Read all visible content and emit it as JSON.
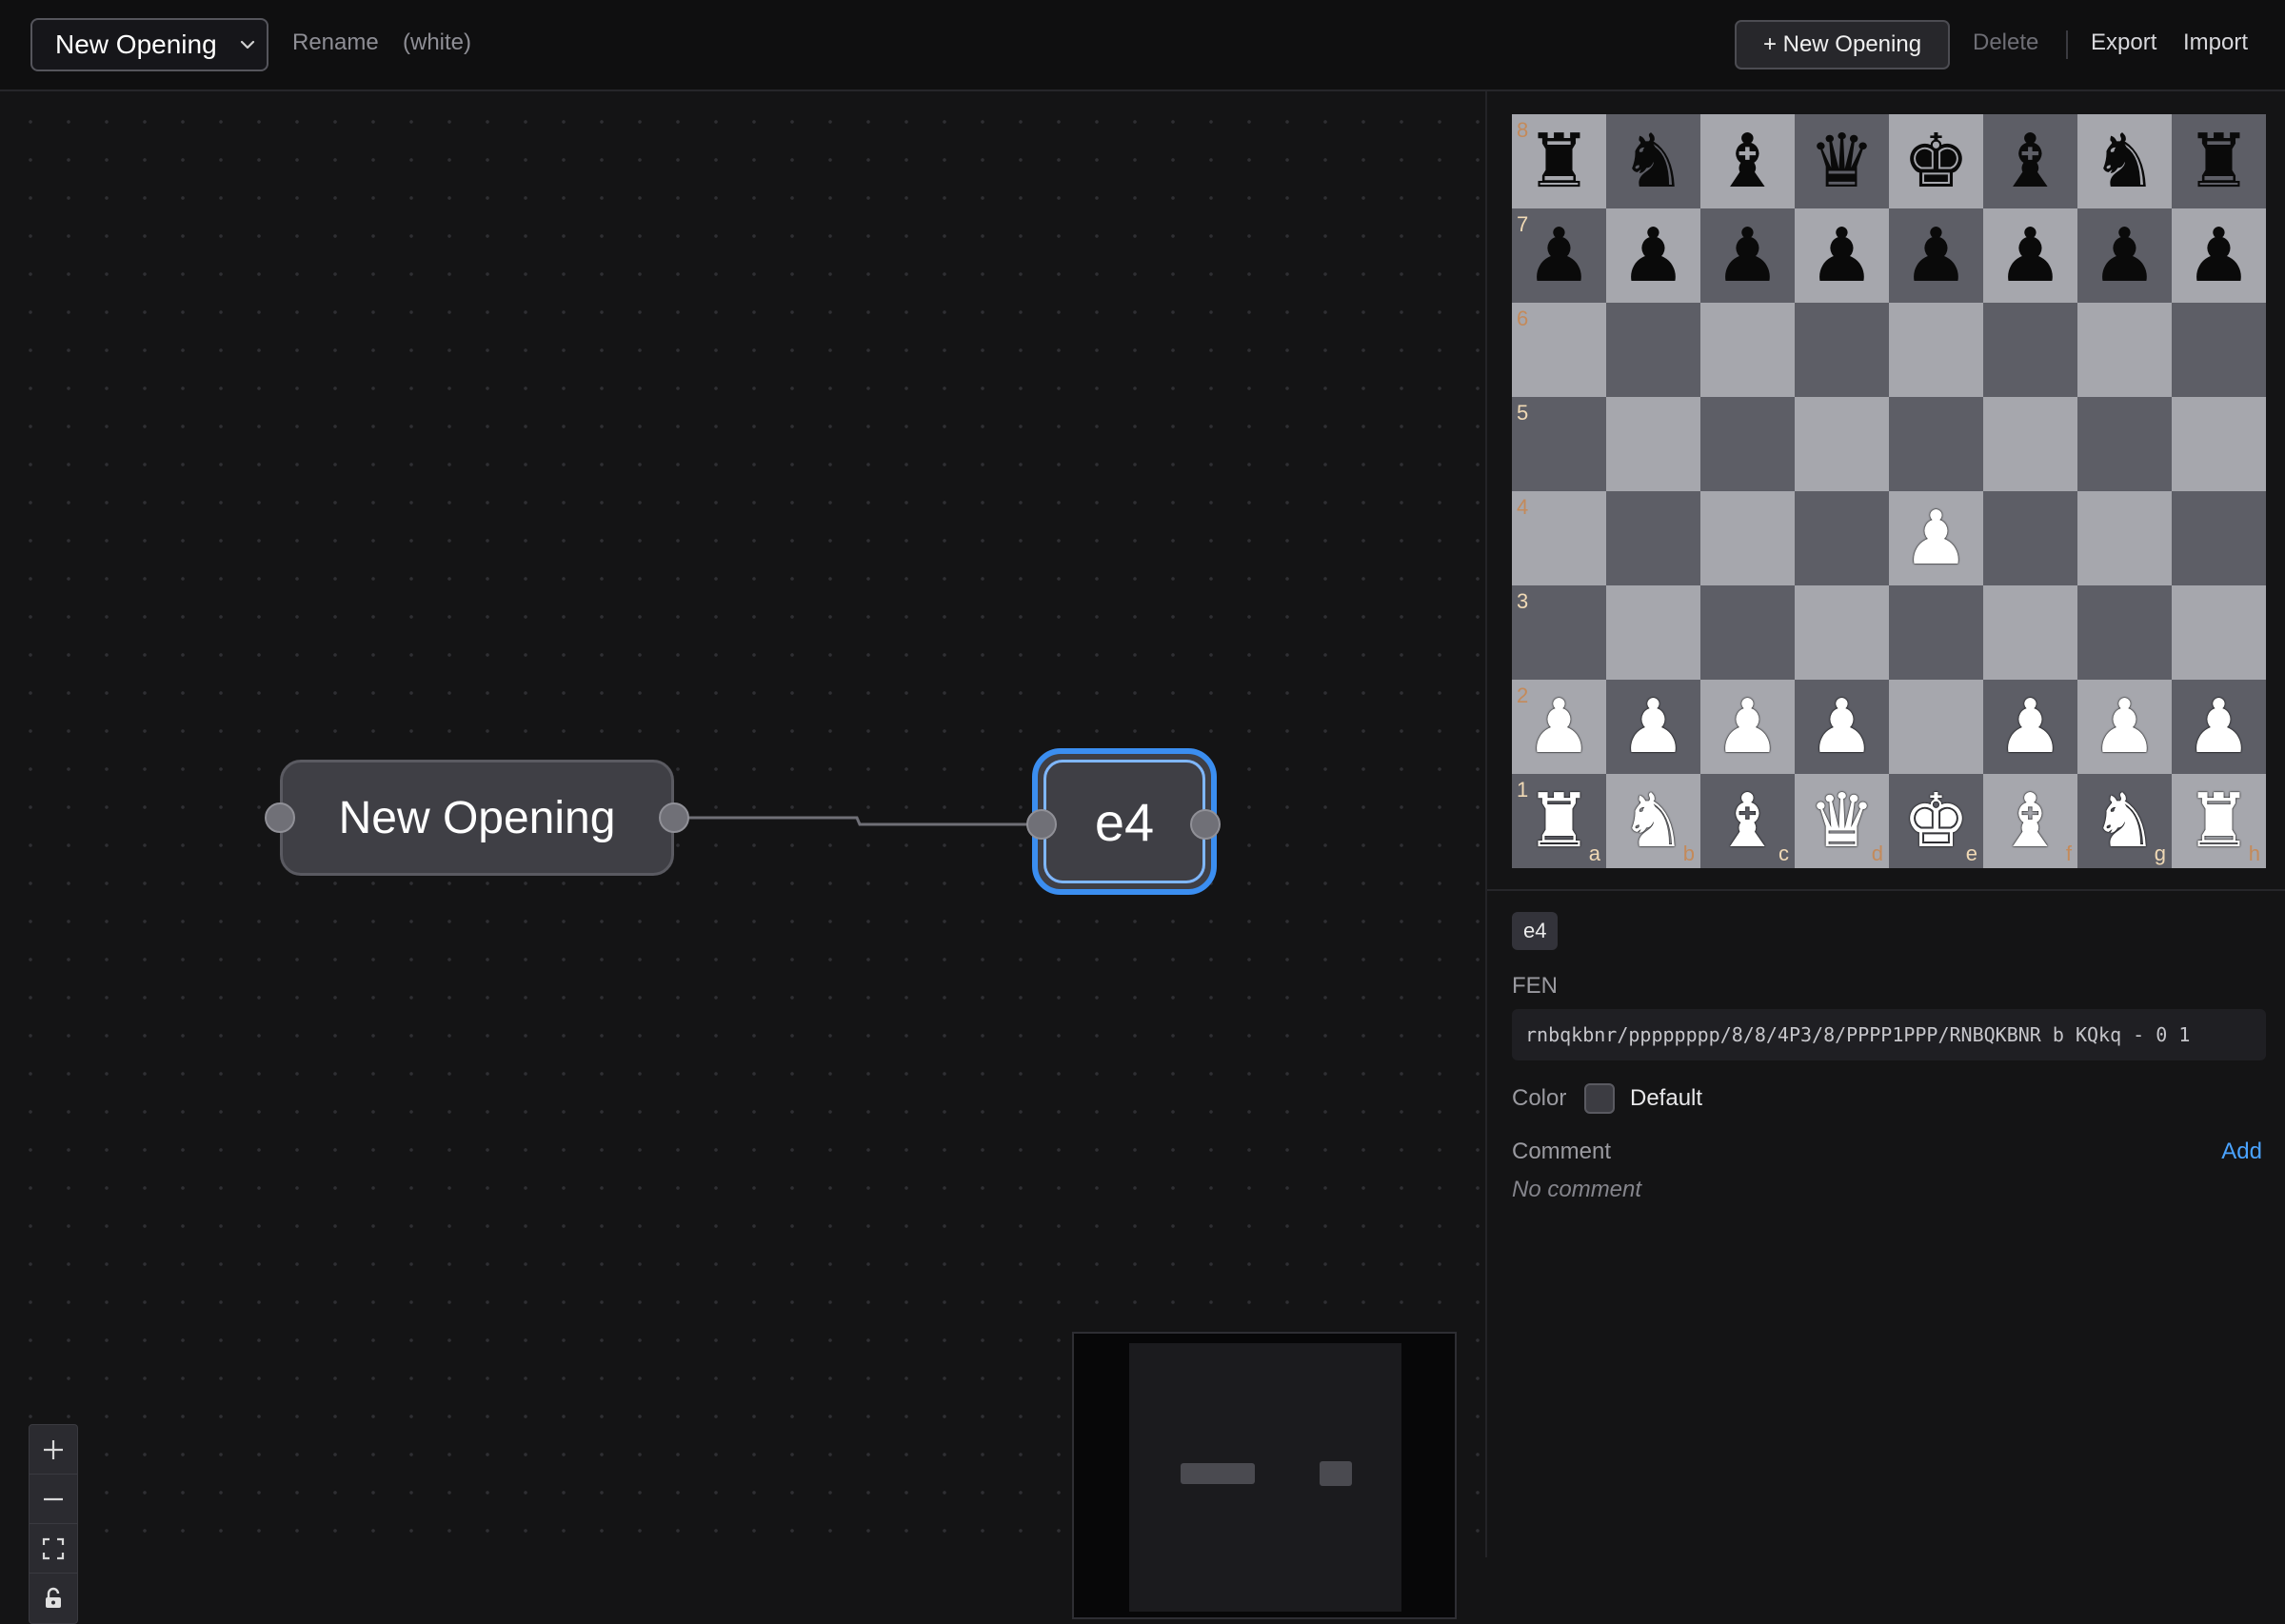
{
  "header": {
    "opening_name": "New Opening",
    "rename_label": "Rename",
    "side_label": "(white)",
    "new_opening_label": "+ New Opening",
    "delete_label": "Delete",
    "export_label": "Export",
    "import_label": "Import"
  },
  "graph": {
    "nodes": [
      {
        "label": "New Opening"
      },
      {
        "label": "e4",
        "selected": true
      }
    ],
    "accent_color": "#3b8ef0",
    "controls": [
      "zoom-in-icon",
      "zoom-out-icon",
      "fit-view-icon",
      "lock-icon"
    ]
  },
  "board": {
    "ranks": [
      [
        "r",
        "n",
        "b",
        "q",
        "k",
        "b",
        "n",
        "r"
      ],
      [
        "p",
        "p",
        "p",
        "p",
        "p",
        "p",
        "p",
        "p"
      ],
      [
        "",
        "",
        "",
        "",
        "",
        "",
        "",
        ""
      ],
      [
        "",
        "",
        "",
        "",
        "",
        "",
        "",
        ""
      ],
      [
        "",
        "",
        "",
        "",
        "P",
        "",
        "",
        ""
      ],
      [
        "",
        "",
        "",
        "",
        "",
        "",
        "",
        ""
      ],
      [
        "P",
        "P",
        "P",
        "P",
        "",
        "P",
        "P",
        "P"
      ],
      [
        "R",
        "N",
        "B",
        "Q",
        "K",
        "B",
        "N",
        "R"
      ]
    ],
    "rank_labels": [
      "8",
      "7",
      "6",
      "5",
      "4",
      "3",
      "2",
      "1"
    ],
    "file_labels": [
      "a",
      "b",
      "c",
      "d",
      "e",
      "f",
      "g",
      "h"
    ],
    "light_color": "#a6a7ad",
    "dark_color": "#5d5e66"
  },
  "details": {
    "move": "e4",
    "fen_label": "FEN",
    "fen": "rnbqkbnr/pppppppp/8/8/4P3/8/PPPP1PPP/RNBQKBNR b KQkq - 0 1",
    "color_label": "Color",
    "color_value": "Default",
    "comment_label": "Comment",
    "add_label": "Add",
    "comment_placeholder": "No comment"
  }
}
